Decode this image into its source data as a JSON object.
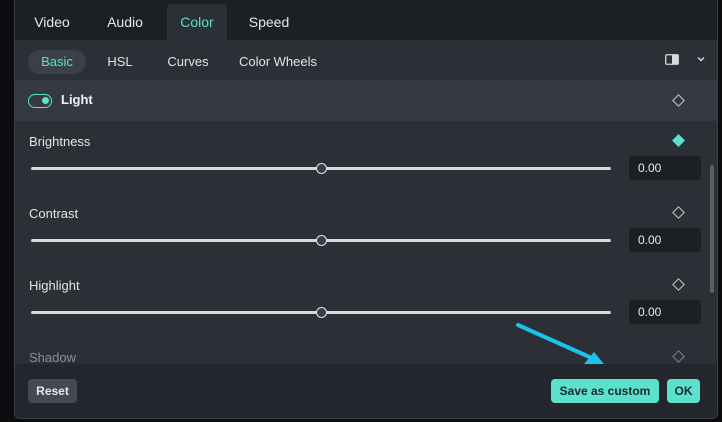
{
  "tabs": [
    {
      "label": "Video"
    },
    {
      "label": "Audio"
    },
    {
      "label": "Color"
    },
    {
      "label": "Speed"
    }
  ],
  "active_tab": "Color",
  "subtabs": [
    {
      "label": "Basic"
    },
    {
      "label": "HSL"
    },
    {
      "label": "Curves"
    },
    {
      "label": "Color Wheels"
    }
  ],
  "active_subtab": "Basic",
  "section": {
    "title": "Light",
    "enabled": true
  },
  "params": [
    {
      "label": "Brightness",
      "value": "0.00",
      "slider_fraction": 0.5,
      "keyframe_active": true
    },
    {
      "label": "Contrast",
      "value": "0.00",
      "slider_fraction": 0.5,
      "keyframe_active": false
    },
    {
      "label": "Highlight",
      "value": "0.00",
      "slider_fraction": 0.5,
      "keyframe_active": false
    },
    {
      "label": "Shadow",
      "keyframe_active": false
    }
  ],
  "footer": {
    "reset_label": "Reset",
    "save_label": "Save as custom",
    "ok_label": "OK"
  },
  "colors": {
    "accent": "#5ce1cf",
    "annotation_arrow": "#19c3ea"
  },
  "icons": [
    "layout-toggle-icon",
    "chevron-down-icon",
    "keyframe-diamond-icon"
  ]
}
